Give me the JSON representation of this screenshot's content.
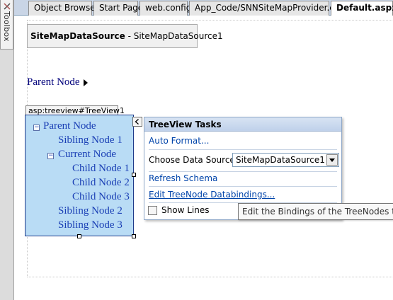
{
  "toolbox": {
    "label": "Toolbox",
    "icon": "toolbox-icon"
  },
  "tabs": [
    {
      "label": "Object Browser",
      "active": false
    },
    {
      "label": "Start Page",
      "active": false
    },
    {
      "label": "web.config",
      "active": false
    },
    {
      "label": "App_Code/SNNSiteMapProvider.cs",
      "active": false
    },
    {
      "label": "Default.aspx",
      "active": true
    }
  ],
  "designer": {
    "sitemapdatasource": {
      "type_label": "SiteMapDataSource",
      "separator": " - ",
      "id": "SiteMapDataSource1"
    },
    "sitemap_path": {
      "label": "Parent Node"
    },
    "treeview": {
      "tag": "asp:treeview#TreeView1",
      "nodes": [
        {
          "label": "Parent Node",
          "expander": "⊟"
        },
        {
          "label": "Sibling Node 1"
        },
        {
          "label": "Current Node",
          "expander": "⊟"
        },
        {
          "label": "Child Node 1"
        },
        {
          "label": "Child Node 2"
        },
        {
          "label": "Child Node 3"
        },
        {
          "label": "Sibling Node 2"
        },
        {
          "label": "Sibling Node 3"
        }
      ],
      "smart_tag_glyph": "<"
    }
  },
  "tasks_panel": {
    "title": "TreeView Tasks",
    "auto_format": "Auto Format...",
    "choose_ds_label": "Choose Data Source:",
    "choose_ds_value": "SiteMapDataSource1",
    "refresh_schema": "Refresh Schema",
    "edit_bindings": "Edit TreeNode Databindings...",
    "show_lines_label": "Show Lines",
    "show_lines_checked": false
  },
  "tooltip": {
    "text": "Edit the Bindings of the TreeNodes to the"
  },
  "colors": {
    "tree_bg": "#b9dcf5",
    "link": "#0044aa",
    "node_text": "#1a3fb5",
    "tab_bar": "#c9d5e6"
  }
}
